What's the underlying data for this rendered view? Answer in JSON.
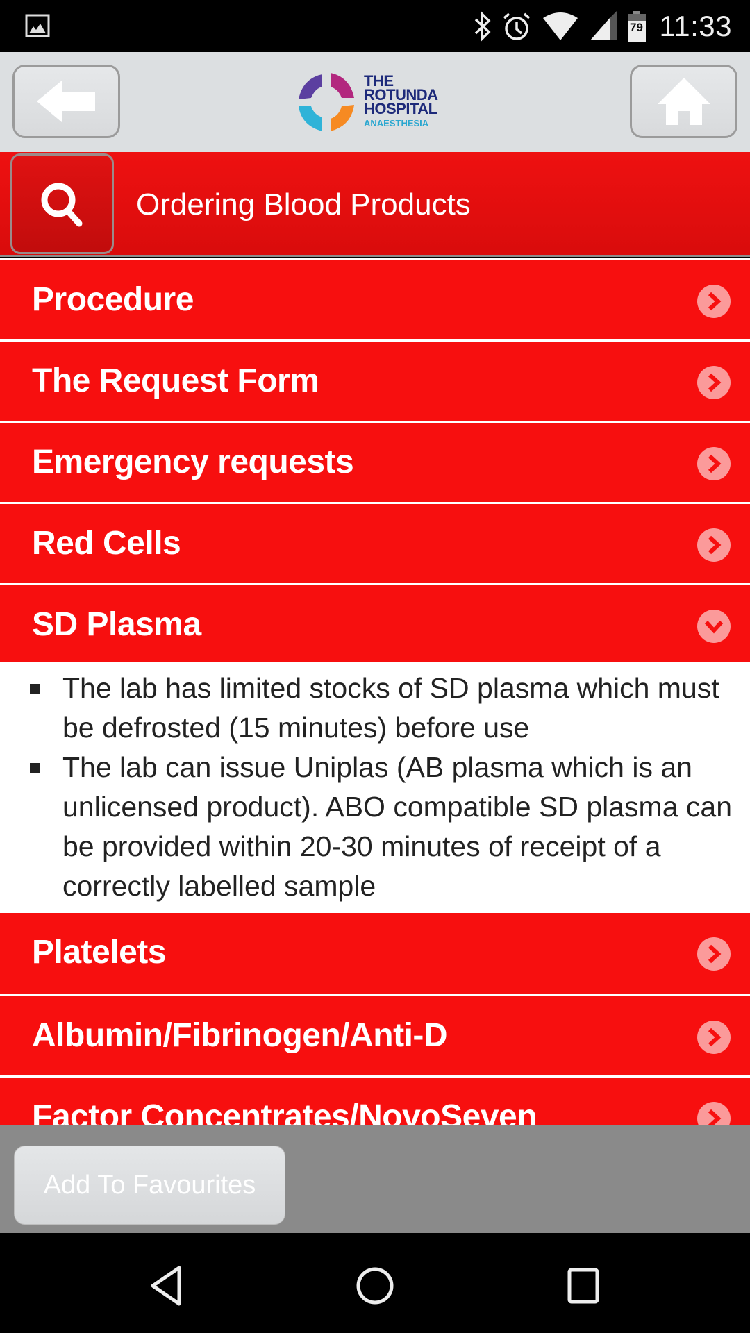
{
  "status_bar": {
    "time": "11:33",
    "battery_percent": "79",
    "icons": [
      "gallery-notification-icon",
      "bluetooth-icon",
      "alarm-icon",
      "wifi-icon",
      "cell-signal-icon",
      "battery-icon"
    ]
  },
  "header": {
    "back_button": "back-arrow-icon",
    "home_button": "home-icon",
    "logo": {
      "line1": "THE",
      "line2": "ROTUNDA",
      "line3": "HOSPITAL",
      "line4": "ANAESTHESIA"
    }
  },
  "title_bar": {
    "search_icon": "search-icon",
    "title": "Ordering Blood Products"
  },
  "sections": [
    {
      "label": "Procedure",
      "expanded": false
    },
    {
      "label": "The Request Form",
      "expanded": false
    },
    {
      "label": "Emergency requests",
      "expanded": false
    },
    {
      "label": "Red Cells",
      "expanded": false
    },
    {
      "label": "SD Plasma",
      "expanded": true,
      "content": [
        "The lab has limited stocks of SD plasma which must be defrosted (15 minutes) before use",
        "The lab can issue Uniplas (AB plasma which is an unlicensed product). ABO compatible SD plasma can be provided within 20-30 minutes of receipt of a correctly labelled sample"
      ]
    },
    {
      "label": "Platelets",
      "expanded": false
    },
    {
      "label": "Albumin/Fibrinogen/Anti-D",
      "expanded": false
    },
    {
      "label": "Factor Concentrates/NovoSeven",
      "expanded": false
    }
  ],
  "footer": {
    "add_favourites": "Add To Favourites"
  },
  "nav_bar": {
    "buttons": [
      "back-nav-icon",
      "home-nav-icon",
      "recents-nav-icon"
    ]
  },
  "colors": {
    "accent_red": "#f70f0f",
    "title_red": "#e40f0f",
    "header_gray": "#dcdfe1",
    "footer_gray": "#8a8a8a",
    "logo_navy": "#1d2a7a",
    "logo_cyan": "#2aa7d0"
  }
}
